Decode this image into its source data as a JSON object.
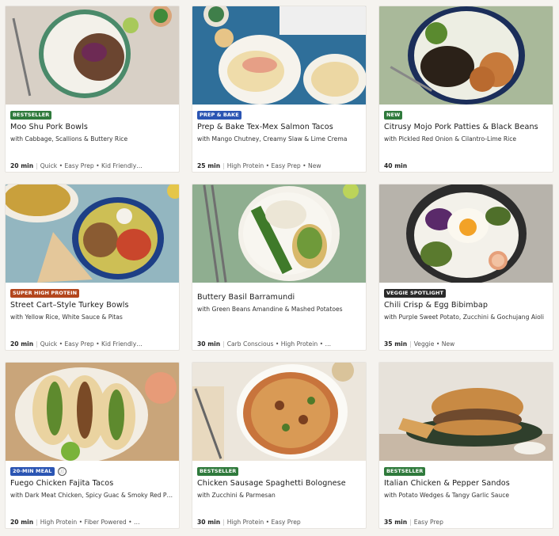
{
  "colors": {
    "bestseller": "#2f7a3c",
    "prep_bake": "#2b55b3",
    "new": "#2f7a3c",
    "super_high_protein": "#b3461d",
    "veggie_spotlight": "#2a2a2a",
    "twenty_min": "#2b55b3"
  },
  "cards": [
    {
      "badge": "BESTSELLER",
      "badge_color": "#2f7a3c",
      "title": "Moo Shu Pork Bowls",
      "subtitle": "with Cabbage, Scallions & Buttery Rice",
      "time": "20 min",
      "tags": "Quick • Easy Prep • Kid Friendly…",
      "image": "pork-rice-bowl"
    },
    {
      "badge": "PREP & BAKE",
      "badge_color": "#2b55b3",
      "title": "Prep & Bake Tex-Mex Salmon Tacos",
      "subtitle": "with Mango Chutney, Creamy Slaw & Lime Crema",
      "time": "25 min",
      "tags": "High Protein • Easy Prep • New",
      "image": "salmon-tacos"
    },
    {
      "badge": "NEW",
      "badge_color": "#2f7a3c",
      "title": "Citrusy Mojo Pork Patties & Black Beans",
      "subtitle": "with Pickled Red Onion & Cilantro-Lime Rice",
      "time": "40 min",
      "tags": "",
      "image": "pork-patties-beans"
    },
    {
      "badge": "SUPER HIGH PROTEIN",
      "badge_color": "#b3461d",
      "title": "Street Cart–Style Turkey Bowls",
      "subtitle": "with Yellow Rice, White Sauce & Pitas",
      "time": "20 min",
      "tags": "Quick • Easy Prep • Kid Friendly…",
      "image": "turkey-bowl"
    },
    {
      "badge": "",
      "badge_color": "",
      "title": "Buttery Basil Barramundi",
      "subtitle": "with Green Beans Amandine & Mashed Potatoes",
      "time": "30 min",
      "tags": "Carb Conscious • High Protein • …",
      "image": "barramundi-plate"
    },
    {
      "badge": "VEGGIE SPOTLIGHT",
      "badge_color": "#2a2a2a",
      "title": "Chili Crisp & Egg Bibimbap",
      "subtitle": "with Purple Sweet Potato, Zucchini & Gochujang Aioli",
      "time": "35 min",
      "tags": "Veggie • New",
      "image": "bibimbap-bowl"
    },
    {
      "badge": "20-MIN MEAL",
      "badge_color": "#2b55b3",
      "info_icon": "ⓘ",
      "title": "Fuego Chicken Fajita Tacos",
      "subtitle": "with Dark Meat Chicken, Spicy Guac & Smoky Red P…",
      "time": "20 min",
      "tags": "High Protein • Fiber Powered • …",
      "image": "fajita-tacos"
    },
    {
      "badge": "BESTSELLER",
      "badge_color": "#2f7a3c",
      "title": "Chicken Sausage Spaghetti Bolognese",
      "subtitle": "with Zucchini & Parmesan",
      "time": "30 min",
      "tags": "High Protein • Easy Prep",
      "image": "spaghetti-bowl"
    },
    {
      "badge": "BESTSELLER",
      "badge_color": "#2f7a3c",
      "title": "Italian Chicken & Pepper Sandos",
      "subtitle": "with Potato Wedges & Tangy Garlic Sauce",
      "time": "35 min",
      "tags": "Easy Prep",
      "image": "chicken-sandwich"
    }
  ]
}
